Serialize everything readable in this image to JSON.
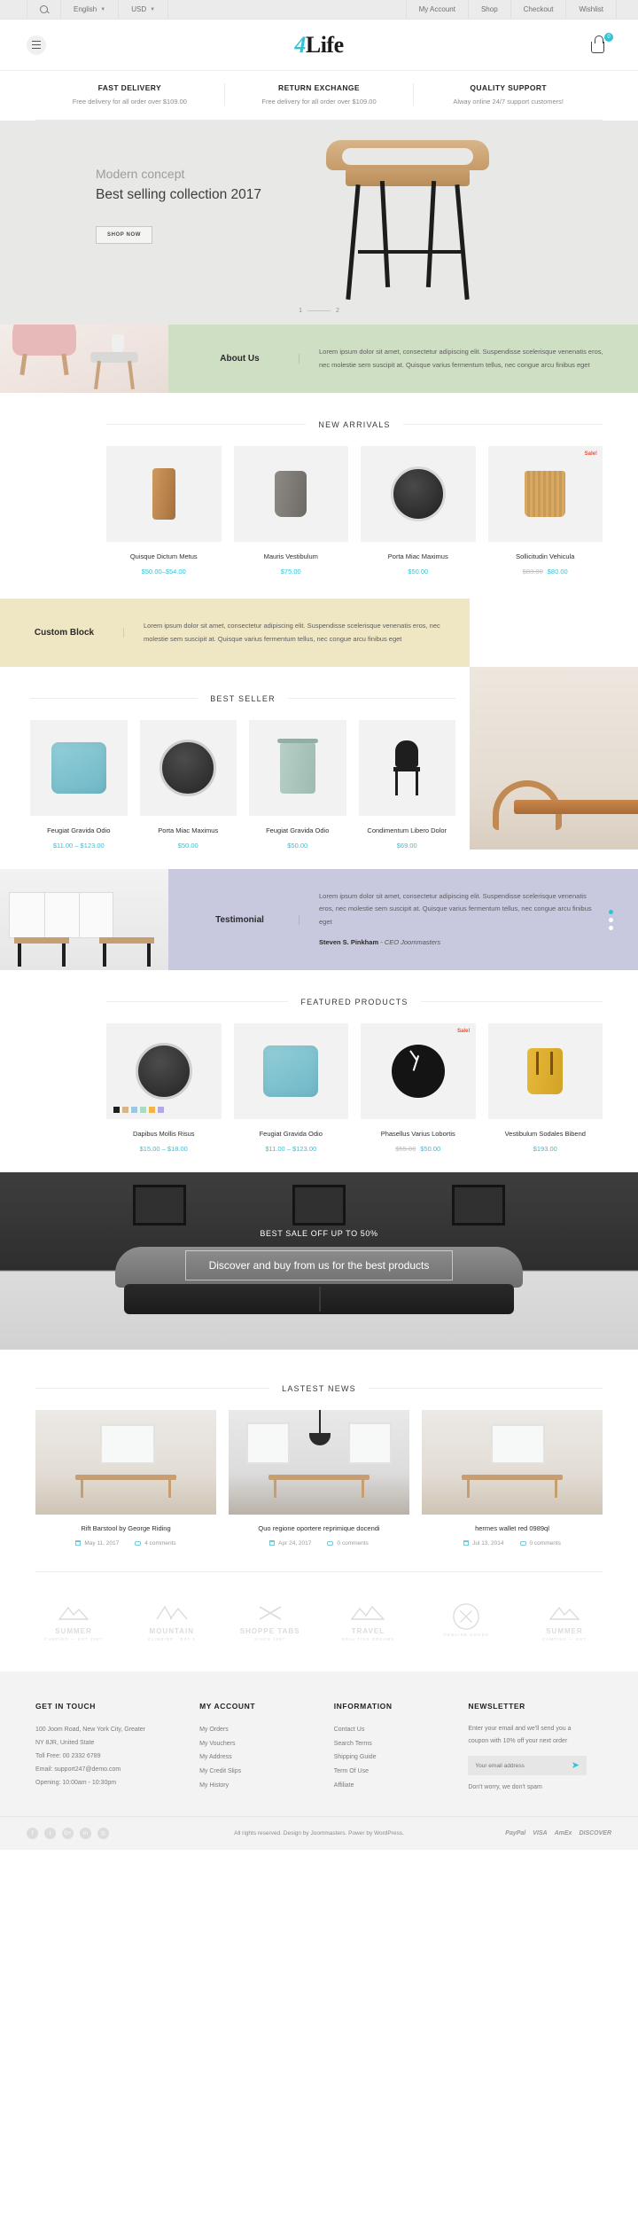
{
  "topbar": {
    "search_icon": "search-icon",
    "language": "English",
    "currency": "USD",
    "links": [
      "My Account",
      "Shop",
      "Checkout",
      "Wishlist"
    ]
  },
  "header": {
    "menu_icon": "hamburger-icon",
    "logo_prefix": "4",
    "logo_text": "Life",
    "cart_icon": "cart-icon",
    "cart_count": "0"
  },
  "services": [
    {
      "title": "FAST DELIVERY",
      "desc": "Free delivery for all order over $109.00"
    },
    {
      "title": "RETURN EXCHANGE",
      "desc": "Free delivery for all order over $109.00"
    },
    {
      "title": "QUALITY SUPPORT",
      "desc": "Alway online 24/7 support customers!"
    }
  ],
  "hero": {
    "subtitle": "Modern concept",
    "title": "Best selling collection 2017",
    "button": "SHOP NOW",
    "slide_current": "1",
    "slide_next": "2"
  },
  "about": {
    "label": "About Us",
    "text": "Lorem ipsum dolor sit amet, consectetur adipiscing elit. Suspendisse scelerisque venenatis eros, nec molestie sem suscipit at. Quisque varius fermentum tellus, nec congue arcu finibus eget"
  },
  "new_arrivals": {
    "title": "NEW ARRIVALS",
    "products": [
      {
        "name": "Quisque Dictum Metus",
        "price": "$50.00–$54.00",
        "old_price": "",
        "sale": ""
      },
      {
        "name": "Mauris Vestibulum",
        "price": "$75.00",
        "old_price": "",
        "sale": ""
      },
      {
        "name": "Porta Miac Maximus",
        "price": "$50.00",
        "old_price": "",
        "sale": ""
      },
      {
        "name": "Sollicitudin Vehicula",
        "price": "$80.00",
        "old_price": "$83.00",
        "sale": "Sale!"
      }
    ]
  },
  "custom_block": {
    "label": "Custom Block",
    "text": "Lorem ipsum dolor sit amet, consectetur adipiscing elit. Suspendisse scelerisque venenatis eros, nec molestie sem suscipit at. Quisque varius fermentum tellus, nec congue arcu finibus eget"
  },
  "best_seller": {
    "title": "BEST SELLER",
    "products": [
      {
        "name": "Feugiat Gravida Odio",
        "price": "$11.00 – $123.00",
        "old_price": "",
        "sale": ""
      },
      {
        "name": "Porta Miac Maximus",
        "price": "$50.00",
        "old_price": "",
        "sale": ""
      },
      {
        "name": "Feugiat Gravida Odio",
        "price": "$50.00",
        "old_price": "",
        "sale": ""
      },
      {
        "name": "Condimentum Libero Dolor",
        "price": "$69.00",
        "old_price": "",
        "sale": ""
      }
    ]
  },
  "testimonial": {
    "label": "Testimonial",
    "text": "Lorem ipsum dolor sit amet, consectetur adipiscing elit. Suspendisse scelerisque venenatis eros, nec molestie sem suscipit at. Quisque varius fermentum tellus, nec congue arcu finibus eget",
    "author": "Steven S. Pinkham",
    "role": "- CEO Joommasters"
  },
  "featured": {
    "title": "FEATURED PRODUCTS",
    "swatch_colors": [
      "#1f1f1f",
      "#d6b58b",
      "#9ec6e0",
      "#a9dcc0",
      "#efb44a",
      "#b3a9e0"
    ],
    "products": [
      {
        "name": "Dapibus Mollis Risus",
        "price": "$15.00 – $18.00",
        "old_price": "",
        "sale": ""
      },
      {
        "name": "Feugiat Gravida Odio",
        "price": "$11.00 – $123.00",
        "old_price": "",
        "sale": ""
      },
      {
        "name": "Phasellus Varius Lobortis",
        "price": "$50.00",
        "old_price": "$55.00",
        "sale": "Sale!"
      },
      {
        "name": "Vestibulum Sodales Bibend",
        "price": "$193.00",
        "old_price": "",
        "sale": ""
      }
    ]
  },
  "promo": {
    "line1": "BEST SALE OFF UP TO 50%",
    "line2": "Discover and buy from us for the best products"
  },
  "news": {
    "title": "LASTEST NEWS",
    "posts": [
      {
        "title": "Rift Barstool by George Riding",
        "date": "May 11, 2017",
        "comments": "4 comments"
      },
      {
        "title": "Quo regione oportere reprimique docendi",
        "date": "Apr 24, 2017",
        "comments": "0 comments"
      },
      {
        "title": "hermes wallet red 0989ql",
        "date": "Jul 13, 2014",
        "comments": "0 comments"
      }
    ]
  },
  "brands": [
    {
      "name": "SUMMER",
      "sub": "CAMPING — EST 1987"
    },
    {
      "name": "MOUNTAIN",
      "sub": "CLIMBING · EST 1"
    },
    {
      "name": "SHOPPE TABS",
      "sub": "SINCE 1997"
    },
    {
      "name": "TRAVEL",
      "sub": "REAL FINE DREAMS"
    },
    {
      "name": "",
      "sub": "GENUINE GOODS"
    },
    {
      "name": "SUMMER",
      "sub": "CAMPING — EST"
    }
  ],
  "footer": {
    "contact": {
      "head": "GET IN TOUCH",
      "lines": [
        "100 Joom Road, New York City, Greater",
        "NY 8JR, United State",
        "Toll Free: 00 2332 6789",
        "Email: support247@demo.com",
        "Opening: 10:00am - 10:30pm"
      ]
    },
    "account": {
      "head": "MY ACCOUNT",
      "links": [
        "My Orders",
        "My Vouchers",
        "My Address",
        "My Credit Slips",
        "My History"
      ]
    },
    "information": {
      "head": "INFORMATION",
      "links": [
        "Contact Us",
        "Search Terms",
        "Shipping Guide",
        "Term Of Use",
        "Affiliate"
      ]
    },
    "newsletter": {
      "head": "NEWSLETTER",
      "desc": "Enter your email and we'll send you a coupon with 10% off your next order",
      "placeholder": "Your email address",
      "submit_icon": "send-icon",
      "note": "Don't worry, we don't spam"
    }
  },
  "bottom": {
    "social": [
      "f",
      "t",
      "G+",
      "in",
      "◎"
    ],
    "copyright": "All rights reserved. Design by Joommasters. Power by WordPress.",
    "payments": [
      "PayPal",
      "VISA",
      "AmEx",
      "DISCOVER"
    ]
  },
  "colors": {
    "accent": "#2ec4d8",
    "sale": "#e8503a",
    "band_green": "#cfdfc4",
    "band_yellow": "#efe7c4",
    "band_purple": "#c8c9de"
  }
}
